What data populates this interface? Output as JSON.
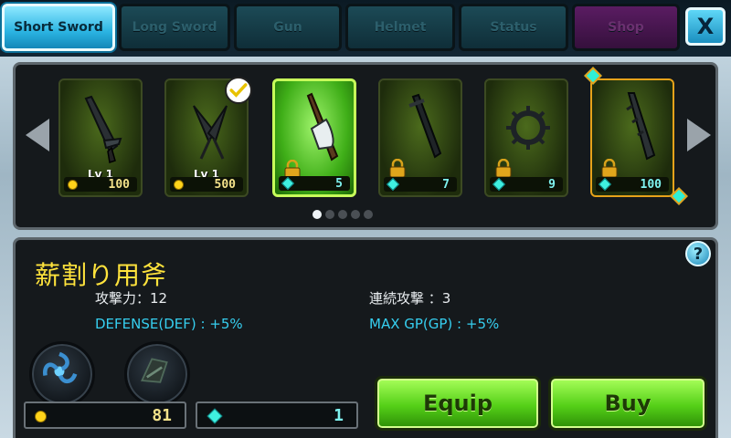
{
  "tabs": [
    {
      "label": "Short Sword",
      "active": true
    },
    {
      "label": "Long Sword",
      "active": false
    },
    {
      "label": "Gun",
      "active": false
    },
    {
      "label": "Helmet",
      "active": false
    },
    {
      "label": "Status",
      "active": false
    },
    {
      "label": "Shop",
      "active": false
    }
  ],
  "close_label": "X",
  "items": [
    {
      "icon": "short-sword-icon",
      "level": "Lv 1",
      "currency": "gold",
      "price": "100",
      "locked": false,
      "equipped": false
    },
    {
      "icon": "kunai-icon",
      "level": "Lv 1",
      "currency": "gold",
      "price": "500",
      "locked": false,
      "equipped": true
    },
    {
      "icon": "axe-icon",
      "level": "",
      "currency": "gem",
      "price": "5",
      "locked": true,
      "equipped": false
    },
    {
      "icon": "dark-blade-icon",
      "level": "",
      "currency": "gem",
      "price": "7",
      "locked": true,
      "equipped": false
    },
    {
      "icon": "spiked-ring-icon",
      "level": "",
      "currency": "gem",
      "price": "9",
      "locked": true,
      "equipped": false
    },
    {
      "icon": "jagged-sword-icon",
      "level": "",
      "currency": "gem",
      "price": "100",
      "locked": true,
      "equipped": false
    }
  ],
  "page_indicator": {
    "current": 1,
    "total": 5
  },
  "detail": {
    "name": "薪割り用斧",
    "attack_label": "攻撃力：12",
    "combo_label": "連続攻撃 ：3",
    "defense_bonus": "DEFENSE(DEF) : +5%",
    "gp_bonus": "MAX GP(GP) : +5%",
    "help_label": "?"
  },
  "currency": {
    "gold": "81",
    "gems": "1"
  },
  "buttons": {
    "equip": "Equip",
    "buy": "Buy"
  },
  "colors": {
    "accent": "#2bb4e2",
    "name": "#ffe33c",
    "bonus": "#36cff0",
    "action": "#55d018"
  }
}
